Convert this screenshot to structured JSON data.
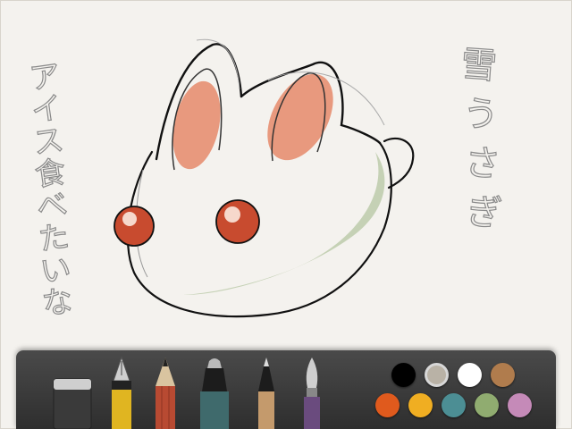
{
  "drawing": {
    "vertical_text_left": [
      "ア",
      "イ",
      "ス",
      "食",
      "べ",
      "た",
      "い",
      "な"
    ],
    "vertical_text_right": [
      "雪",
      "う",
      "さ",
      "ぎ"
    ]
  },
  "toolbar": {
    "tools": [
      {
        "name": "eraser-tool",
        "color": "#3a3a3a"
      },
      {
        "name": "fountain-pen-tool",
        "color": "#e0b521"
      },
      {
        "name": "pencil-tool",
        "color": "#b84a32"
      },
      {
        "name": "marker-tool",
        "color": "#3f6a6c"
      },
      {
        "name": "fine-pen-tool",
        "color": "#c49a6c"
      },
      {
        "name": "brush-tool",
        "color": "#6a4b7e"
      }
    ],
    "palette": [
      {
        "color": "#000000",
        "selected": false
      },
      {
        "color": "#b9b2a6",
        "selected": true
      },
      {
        "color": "#ffffff",
        "selected": false
      },
      {
        "color": "#b07c4d",
        "selected": false
      },
      {
        "color": "#e05a1d",
        "selected": false
      },
      {
        "color": "#f0ae22",
        "selected": false
      },
      {
        "color": "#4c8e94",
        "selected": false
      },
      {
        "color": "#90ac70",
        "selected": false
      },
      {
        "color": "#c58ab8",
        "selected": false
      }
    ]
  }
}
